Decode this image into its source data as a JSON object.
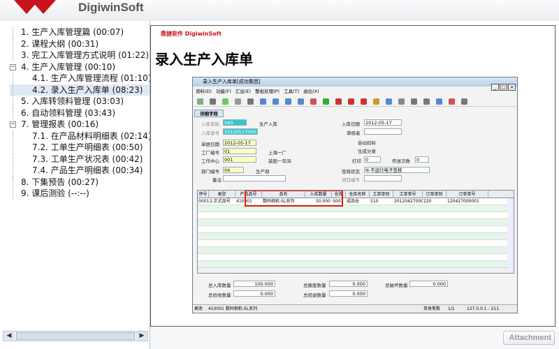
{
  "app": {
    "brand": "DigiwinSoft"
  },
  "toc": [
    {
      "label": "1. 生产入库管理篇 (00:07)",
      "level": 0
    },
    {
      "label": "2. 课程大纲 (00:31)",
      "level": 0
    },
    {
      "label": "3. 完工入库管理方式说明 (01:22)",
      "level": 0
    },
    {
      "label": "4. 生产入库管理 (00:10)",
      "level": 0,
      "expander": "−"
    },
    {
      "label": "4.1. 生产入库管理流程 (01:10)",
      "level": 2
    },
    {
      "label": "4.2. 录入生产入库单 (08:23)",
      "level": 2,
      "selected": true
    },
    {
      "label": "5. 入库转领料管理 (03:03)",
      "level": 0
    },
    {
      "label": "6. 自动领料管理 (03:43)",
      "level": 0
    },
    {
      "label": "7. 管理报表 (00:16)",
      "level": 0,
      "expander": "−"
    },
    {
      "label": "7.1. 在产品材料明细表 (02:14)",
      "level": 2
    },
    {
      "label": "7.2. 工单生产明细表 (00:50)",
      "level": 2
    },
    {
      "label": "7.3. 工单生产状况表 (00:42)",
      "level": 2
    },
    {
      "label": "7.4. 产品生产明细表 (00:34)",
      "level": 2
    },
    {
      "label": "8. 下集预告 (00:27)",
      "level": 0
    },
    {
      "label": "9. 课后测验 (--:--)",
      "level": 0
    }
  ],
  "slide": {
    "logo": "鼎捷软件 DigiwinSoft",
    "title": "录入生产入库单"
  },
  "erp": {
    "window_title": "录入生产入库单[成功集团]",
    "menu": [
      "资料(D)",
      "功能(F)",
      "汇出(E)",
      "整批处理(P)",
      "工具(T)",
      "退出(X)"
    ],
    "tab": "详细字段",
    "fields": {
      "doc_type_label": "入库单别",
      "doc_type_value": "580",
      "doc_type_name": "生产入库",
      "doc_no_label": "入库单号",
      "doc_no_value": "201205170001",
      "doc_date_label": "单据日期",
      "doc_date_value": "2012-05-17",
      "plant_label": "工厂编号",
      "plant_value": "01",
      "plant_name": "上海一厂",
      "wc_label": "工作中心",
      "wc_value": "001",
      "wc_name": "装配一车间",
      "dept_label": "部门编号",
      "dept_value": "04",
      "dept_name": "生产部",
      "note_label": "备注",
      "in_date_label": "入库日期",
      "in_date_value": "2012-05-17",
      "approver_label": "审核者",
      "auto_issue": "自动扣料",
      "gen_split": "生成分录",
      "print_label": "打印",
      "print_value": "0",
      "send_label": "传送次数",
      "send_value": "0",
      "sign_label": "签核状态",
      "sign_value": "N:不运行电子签核",
      "proj_label": "项目编号"
    },
    "grid": {
      "headers": [
        "序号",
        "类型",
        "产品品号",
        "品名",
        "入库数量",
        "仓库",
        "仓库名称",
        "工单单别",
        "工单单号",
        "订单单别",
        "订单单号"
      ],
      "rows": [
        [
          "0001",
          "2.正式品号",
          "410001",
          "数码相机-SL系列",
          "50.000",
          "S003",
          "成品仓",
          "510",
          "201204270001",
          "220",
          "120427000001"
        ]
      ]
    },
    "totals": {
      "in_qty_label": "总入库数量",
      "in_qty": "100.000",
      "scrap_label": "总报废数量",
      "scrap": "0.000",
      "damage_label": "总破坏数量",
      "damage": "0.000",
      "accept_label": "总验收数量",
      "accept": "0.000",
      "reject_label": "总验退数量",
      "reject": "0.000"
    },
    "status": {
      "left": "更改",
      "item": "410001 数码相机-SL系列",
      "count_label": "单身笔数",
      "count": "1/1",
      "ip": "127.0.0.1 - 211"
    }
  },
  "attachment_label": "Attachment"
}
